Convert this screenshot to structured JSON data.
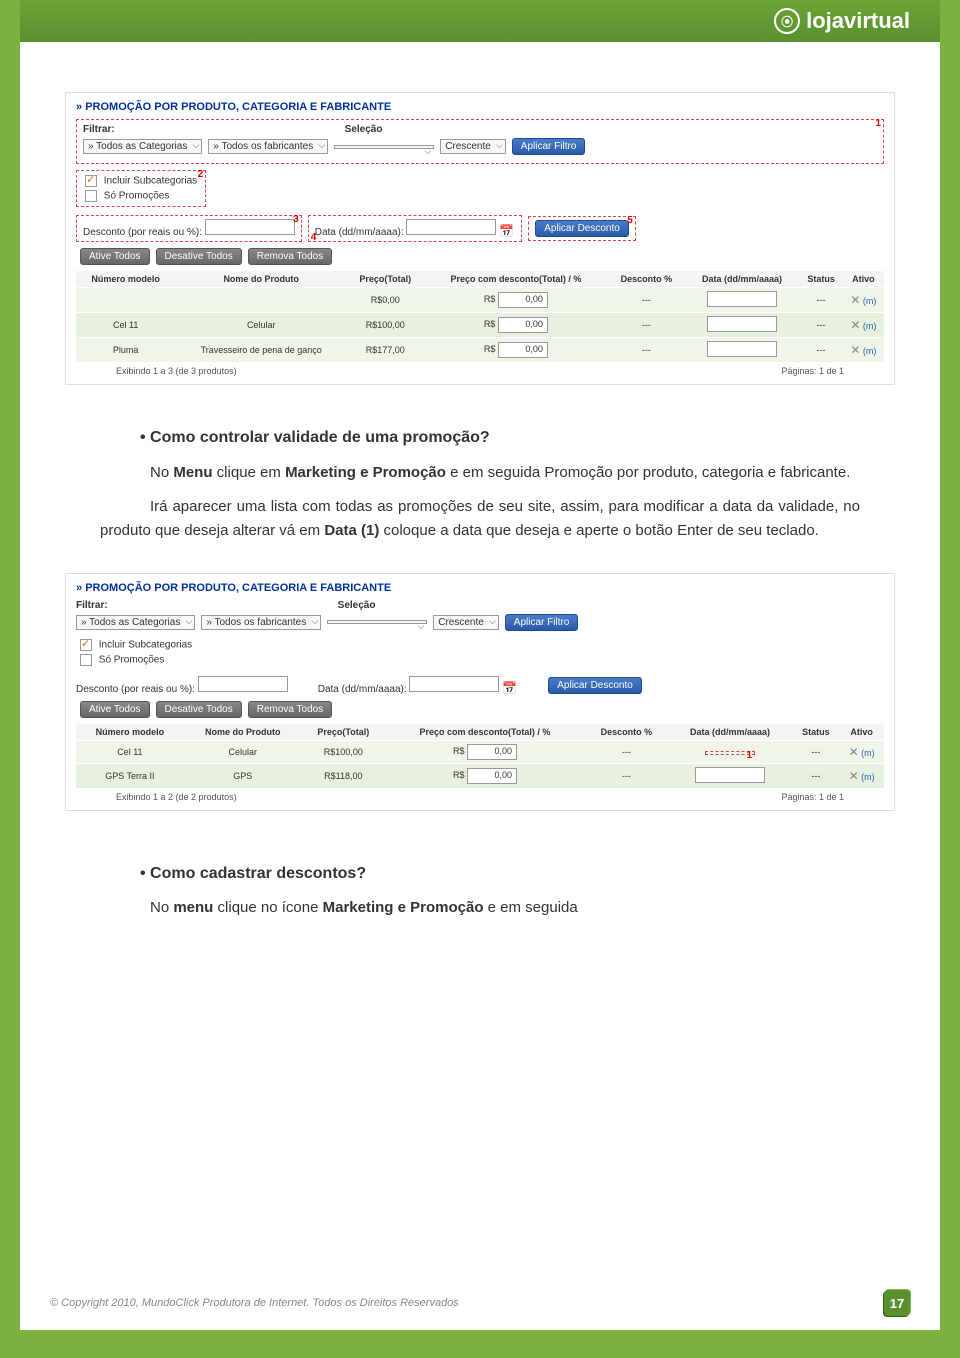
{
  "header": {
    "brand": "lojavirtual"
  },
  "screenshot1": {
    "title": "PROMOÇÃO POR PRODUTO, CATEGORIA E FABRICANTE",
    "filtrar_label": "Filtrar:",
    "selecao_label": "Seleção",
    "categorias": "» Todos as Categorias",
    "fabricantes": "» Todos os fabricantes",
    "crescente": "Crescente",
    "aplicar_filtro": "Aplicar Filtro",
    "incluir_sub": "Incluir Subcategorias",
    "so_promo": "Só Promoções",
    "desconto_label": "Desconto (por reais ou %):",
    "data_label": "Data (dd/mm/aaaa):",
    "aplicar_desconto": "Aplicar Desconto",
    "ative_todos": "Ative Todos",
    "desative_todos": "Desative Todos",
    "remova_todos": "Remova Todos",
    "markers": {
      "m1": "1",
      "m2": "2",
      "m3": "3",
      "m4": "4",
      "m5": "5"
    },
    "th": {
      "numero": "Número modelo",
      "nome": "Nome do Produto",
      "preco": "Preço(Total)",
      "preco_desc": "Preço com desconto(Total) / %",
      "desconto": "Desconto %",
      "data": "Data (dd/mm/aaaa)",
      "status": "Status",
      "ativo": "Ativo"
    },
    "rows": [
      {
        "numero": "",
        "nome": "",
        "preco": "R$0,00",
        "rs": "R$",
        "val": "0,00",
        "desconto": "---",
        "data": "",
        "status": "---"
      },
      {
        "numero": "Cel 11",
        "nome": "Celular",
        "preco": "R$100,00",
        "rs": "R$",
        "val": "0,00",
        "desconto": "---",
        "data": "",
        "status": "---"
      },
      {
        "numero": "Pluma",
        "nome": "Travesseiro de pena de ganço",
        "preco": "R$177,00",
        "rs": "R$",
        "val": "0,00",
        "desconto": "---",
        "data": "",
        "status": "---"
      }
    ],
    "exibindo": "Exibindo 1 a 3 (de 3 produtos)",
    "paginas": "Páginas: 1 de 1",
    "m_badge": "(m)"
  },
  "text1": {
    "heading": "Como controlar validade de uma promoção?",
    "p1_a": "No ",
    "p1_b": "Menu",
    "p1_c": " clique em ",
    "p1_d": "Marketing e Promoção",
    "p1_e": " e em seguida Promoção por produto, categoria e fabricante.",
    "p2_a": "Irá aparecer uma lista com todas as promoções de seu site, assim, para modificar a data da validade, no produto que deseja alterar vá em ",
    "p2_b": "Data (1)",
    "p2_c": " coloque a data que deseja e aperte o botão Enter de seu teclado."
  },
  "screenshot2": {
    "title": "PROMOÇÃO POR PRODUTO, CATEGORIA E FABRICANTE",
    "rows": [
      {
        "numero": "Cel 11",
        "nome": "Celular",
        "preco": "R$100,00",
        "rs": "R$",
        "val": "0,00",
        "desconto": "---",
        "status": "---"
      },
      {
        "numero": "GPS Terra II",
        "nome": "GPS",
        "preco": "R$118,00",
        "rs": "R$",
        "val": "0,00",
        "desconto": "---",
        "status": "---"
      }
    ],
    "marker1": "1",
    "exibindo": "Exibindo 1 a 2 (de 2 produtos)",
    "paginas": "Páginas: 1 de 1"
  },
  "text2": {
    "heading": "Como cadastrar descontos?",
    "p1_a": "No ",
    "p1_b": "menu",
    "p1_c": " clique no ícone ",
    "p1_d": "Marketing e Promoção",
    "p1_e": " e em seguida"
  },
  "footer": {
    "copyright": "© Copyright 2010, MundoClick Produtora de Internet. Todos os Direitos Reservados",
    "page_num": "17"
  }
}
